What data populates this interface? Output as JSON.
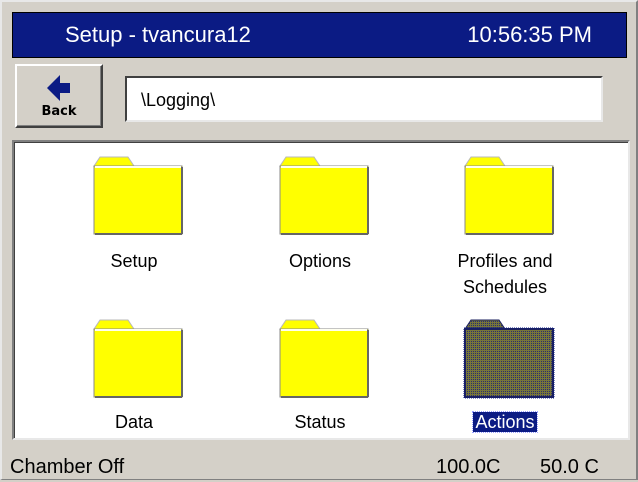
{
  "titlebar": {
    "title": "Setup - tvancura12",
    "time": "10:56:35 PM"
  },
  "toolbar": {
    "back_label": "Back",
    "path_value": "\\Logging\\"
  },
  "folders": [
    {
      "label": "Setup",
      "icon": "folder-icon",
      "selected": false
    },
    {
      "label": "Options",
      "icon": "folder-icon",
      "selected": false
    },
    {
      "label": "Profiles and Schedules",
      "icon": "folder-icon",
      "selected": false
    },
    {
      "label": "Data",
      "icon": "folder-icon",
      "selected": false
    },
    {
      "label": "Status",
      "icon": "folder-icon",
      "selected": false
    },
    {
      "label": "Actions",
      "icon": "folder-icon",
      "selected": true
    }
  ],
  "status": {
    "mode": "Chamber Off",
    "temp1": "100.0C",
    "temp2": "50.0 C"
  },
  "colors": {
    "title_bg": "#0b1b84",
    "folder": "#ffff00",
    "selection": "#0b1b84"
  }
}
